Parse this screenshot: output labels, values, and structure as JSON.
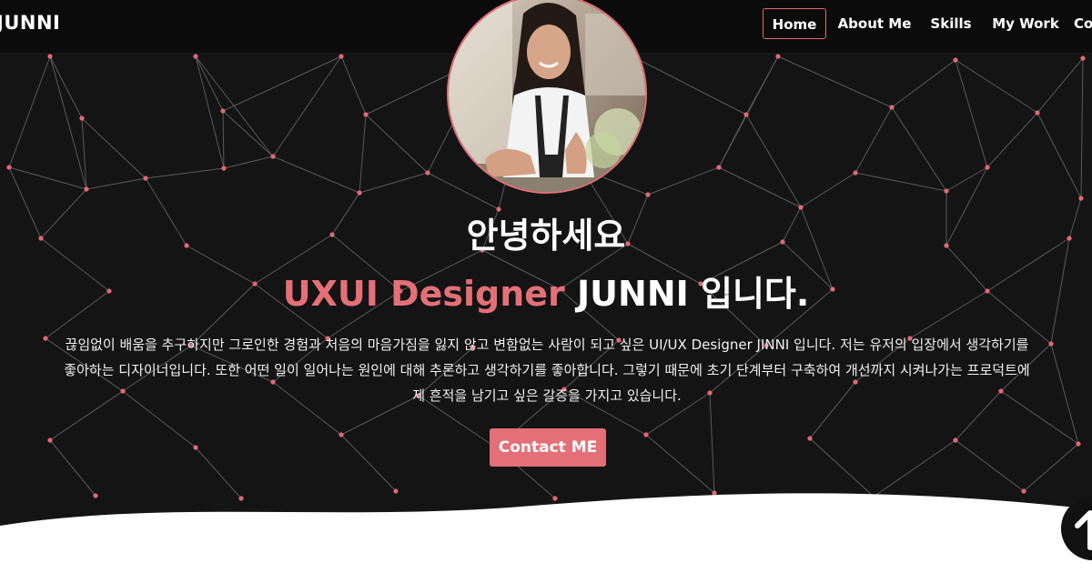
{
  "navbar": {
    "brand": "JUNNI",
    "items": [
      {
        "label": "Home",
        "active": true
      },
      {
        "label": "About Me"
      },
      {
        "label": "Skills"
      },
      {
        "label": "My Work"
      },
      {
        "label": "Contact"
      }
    ]
  },
  "hero": {
    "greeting": "안녕하세요",
    "role": "UXUI Designer",
    "name_line": " JUNNI 입니다.",
    "intro": "끊임없이 배움을 추구하지만 그로인한 경험과 처음의 마음가짐을 잃지 않고 변함없는 사람이 되고 싶은 UI/UX Designer JINNI 입니다. 저는 유저의 입장에서 생각하기를 좋아하는 디자이너입니다. 또한 어떤 일이 일어나는 원인에 대해 추론하고 생각하기를 좋아합니다. 그렇기 때문에 초기 단계부터 구축하여 개선까지 시켜나가는 프로덕트에 제 흔적을 남기고 싶은 갈증을 가지고 있습니다.",
    "contact_button": "Contact ME"
  },
  "icons": {
    "scroll_top": "arrow-up-icon",
    "avatar": "profile-photo"
  },
  "colors": {
    "accent": "#e47077",
    "background": "#141414",
    "navbar": "#0b0b0b",
    "network_line": "#5a5a5a",
    "network_node": "#e06a70"
  }
}
